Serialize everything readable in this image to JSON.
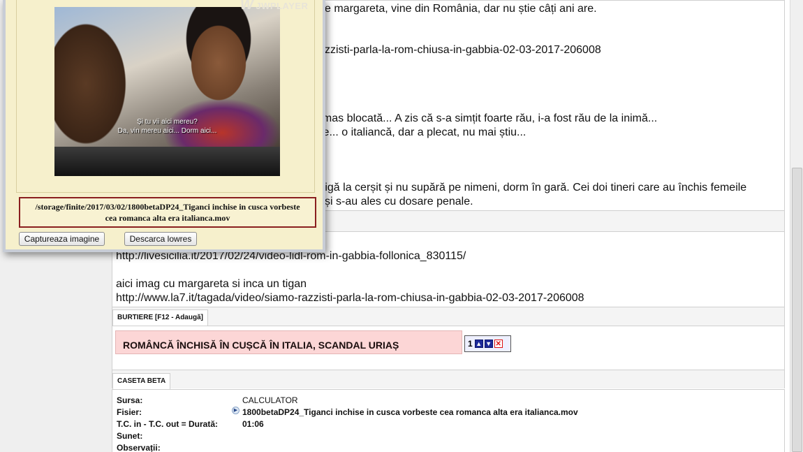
{
  "content": {
    "lines_top": [
      "e margareta, vine din România, dar nu știe câți ani are.",
      "zzisti-parla-la-rom-chiusa-in-gabbia-02-03-2017-206008",
      "ămas blocată... A zis că s-a simțit foarte rău, i-a fost rău de la inimă...",
      "le... o italiancă, dar a plecat, nu mai știu...",
      "ețigă la cerșit și nu supără pe nimeni, dorm în gară. Cei doi tineri care au închis femeile",
      "și s-au ales cu dosare penale."
    ],
    "lines_bottom": [
      "http://livesicilia.it/2017/02/24/video-lidl-rom-in-gabbia-follonica_830115/",
      "aici imag cu margareta si inca un tigan",
      "http://www.la7.it/tagada/video/siamo-razzisti-parla-la-rom-chiusa-in-gabbia-02-03-2017-206008"
    ]
  },
  "burtiere": {
    "tab_label": "BURTIERE [F12 - Adaugă]",
    "item_text": "ROMÂNCĂ ÎNCHISĂ ÎN CUȘCĂ ÎN ITALIA, SCANDAL URIAȘ",
    "item_number": "1",
    "up_icon": "arrow-up-icon",
    "down_icon": "arrow-down-icon",
    "delete_icon": "close-icon"
  },
  "caseta": {
    "tab_label": "CASETA BETA",
    "rows": [
      {
        "label": "Sursa:",
        "value": "CALCULATOR"
      },
      {
        "label": "Fisier:",
        "value": "1800betaDP24_Tiganci inchise in cusca vorbeste cea romanca alta era italianca.mov"
      },
      {
        "label": "T.C. in - T.C. out = Durată:",
        "value": "01:06"
      },
      {
        "label": "Sunet:",
        "value": ""
      },
      {
        "label": "Observații:",
        "value": ""
      }
    ]
  },
  "player": {
    "logo": "JWPLAYER",
    "subtitle_1": "Și tu vii aici mereu?",
    "subtitle_2": "Da, vin mereu aici... Dorm aici...",
    "path_line_1": "/storage/finite/2017/03/02/1800betaDP24_Tiganci inchise in cusca vorbeste",
    "path_line_2": "cea romanca alta era italianca.mov",
    "capture_button": "Captureaza imagine",
    "download_button": "Descarca lowres"
  },
  "colors": {
    "burtiera_bg": "#fcd6d6",
    "popup_bg": "#f6f0cc",
    "path_border": "#8a1f1f"
  }
}
